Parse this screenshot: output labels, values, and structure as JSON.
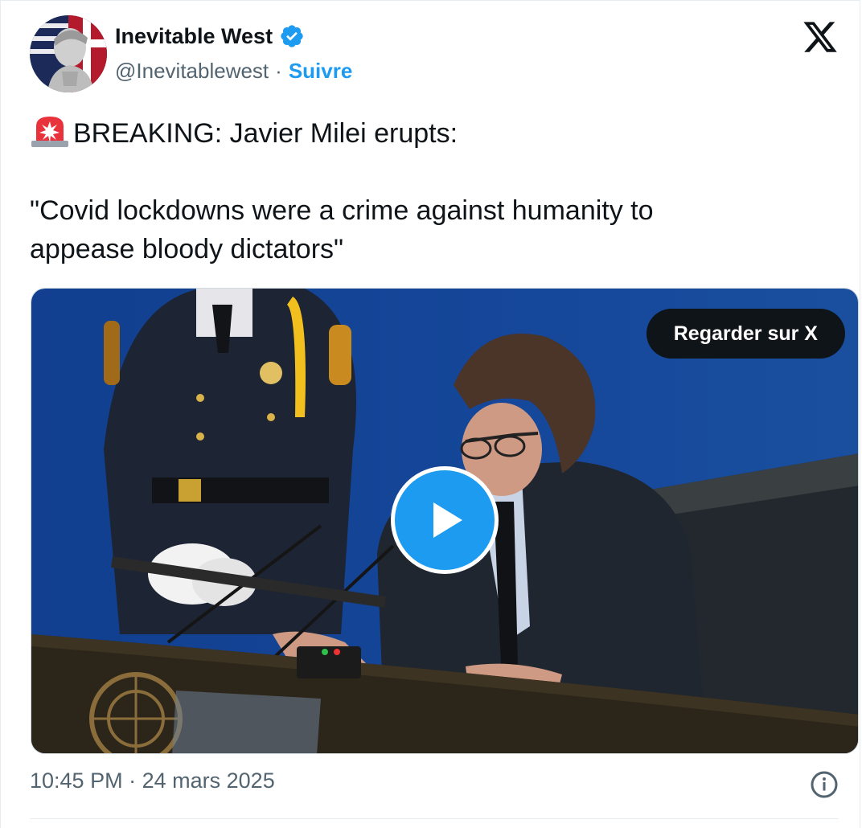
{
  "author": {
    "name": "Inevitable West",
    "handle": "@Inevitablewest",
    "separator": "·",
    "follow_label": "Suivre"
  },
  "icons": {
    "verified": "verified-badge-icon",
    "platform": "x-logo-icon",
    "alarm": "rotating-light-icon",
    "play": "play-icon",
    "info": "info-icon"
  },
  "tweet": {
    "line1": "BREAKING: Javier Milei erupts:",
    "line2": "\"Covid lockdowns were a crime against humanity to",
    "line3": "appease bloody dictators\""
  },
  "media": {
    "watch_label": "Regarder sur X"
  },
  "meta": {
    "time": "10:45 PM",
    "separator": "·",
    "date": "24 mars 2025"
  },
  "colors": {
    "accent": "#1d9bf0",
    "text": "#0f1419",
    "muted": "#536471",
    "background": "#ffffff"
  }
}
